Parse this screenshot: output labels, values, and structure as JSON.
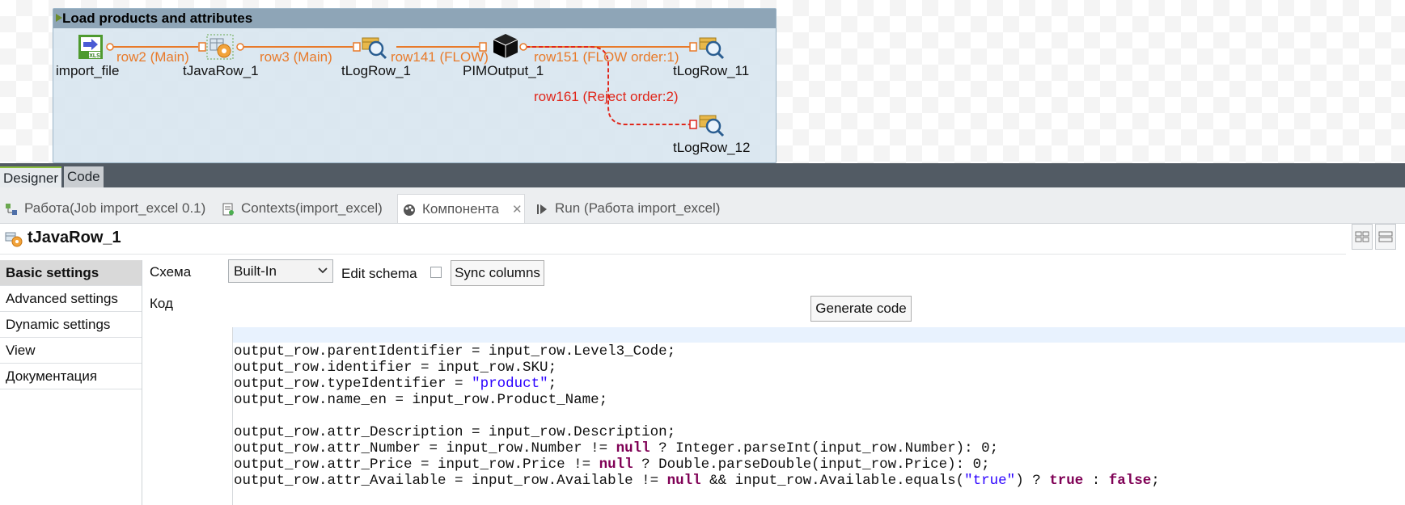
{
  "subjob": {
    "title": "Load products and attributes"
  },
  "components": [
    {
      "id": "import_file",
      "label": "import_file",
      "icon": "xls-input-icon"
    },
    {
      "id": "tJavaRow_1",
      "label": "tJavaRow_1",
      "icon": "java-row-icon"
    },
    {
      "id": "tLogRow_1",
      "label": "tLogRow_1",
      "icon": "log-row-icon"
    },
    {
      "id": "PIMOutput_1",
      "label": "PIMOutput_1",
      "icon": "black-cube-icon"
    },
    {
      "id": "tLogRow_11",
      "label": "tLogRow_11",
      "icon": "log-row-icon"
    },
    {
      "id": "tLogRow_12",
      "label": "tLogRow_12",
      "icon": "log-row-icon"
    }
  ],
  "flows": [
    {
      "label": "row2 (Main)",
      "color": "#e87a2a"
    },
    {
      "label": "row3 (Main)",
      "color": "#e87a2a"
    },
    {
      "label": "row141 (FLOW)",
      "color": "#e87a2a"
    },
    {
      "label": "row151 (FLOW order:1)",
      "color": "#e87a2a"
    },
    {
      "label": "row161 (Reject order:2)",
      "color": "#e0271b"
    }
  ],
  "editor_tabs": {
    "designer": "Designer",
    "code": "Code"
  },
  "view_tabs": [
    {
      "label": "Работа(Job import_excel 0.1)",
      "icon": "job-icon"
    },
    {
      "label": "Contexts(import_excel)",
      "icon": "contexts-icon"
    },
    {
      "label": "Компонента",
      "icon": "component-icon",
      "active": true,
      "close": "✕"
    },
    {
      "label": "Run (Работа import_excel)",
      "icon": "run-icon"
    }
  ],
  "component_header": {
    "title": "tJavaRow_1"
  },
  "settings_nav": [
    {
      "label": "Basic settings",
      "active": true
    },
    {
      "label": "Advanced settings"
    },
    {
      "label": "Dynamic settings"
    },
    {
      "label": "View"
    },
    {
      "label": "Документация"
    }
  ],
  "form": {
    "schema_label": "Схема",
    "schema_value": "Built-In",
    "edit_schema_label": "Edit schema",
    "sync_columns": "Sync columns",
    "code_label": "Код",
    "generate_code": "Generate code"
  },
  "code": [
    [
      {
        "t": "output_row.parentIdentifier = input_row.Level3_Code;"
      }
    ],
    [
      {
        "t": "output_row.identifier = input_row.SKU;"
      }
    ],
    [
      {
        "t": "output_row.typeIdentifier = "
      },
      {
        "t": "\"product\"",
        "c": "str"
      },
      {
        "t": ";"
      }
    ],
    [
      {
        "t": "output_row.name_en = input_row.Product_Name;"
      }
    ],
    [],
    [
      {
        "t": "output_row.attr_Description = input_row.Description;"
      }
    ],
    [
      {
        "t": "output_row.attr_Number = input_row.Number != "
      },
      {
        "t": "null",
        "c": "kw"
      },
      {
        "t": " ? Integer.parseInt(input_row.Number): 0;"
      }
    ],
    [
      {
        "t": "output_row.attr_Price = input_row.Price != "
      },
      {
        "t": "null",
        "c": "kw"
      },
      {
        "t": " ? Double.parseDouble(input_row.Price): 0;"
      }
    ],
    [
      {
        "t": "output_row.attr_Available = input_row.Available != "
      },
      {
        "t": "null",
        "c": "kw"
      },
      {
        "t": " && input_row.Available.equals("
      },
      {
        "t": "\"true\"",
        "c": "str"
      },
      {
        "t": ") ? "
      },
      {
        "t": "true",
        "c": "kw"
      },
      {
        "t": " : "
      },
      {
        "t": "false",
        "c": "kw"
      },
      {
        "t": ";"
      }
    ]
  ]
}
